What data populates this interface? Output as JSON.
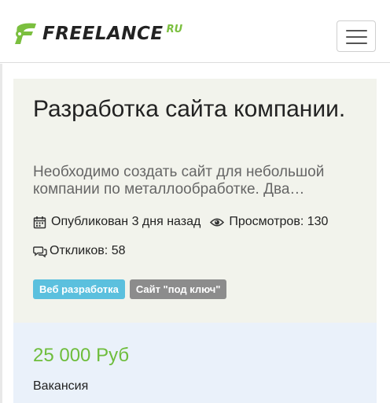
{
  "header": {
    "logo_text": "FREELANCE",
    "logo_suffix": "RU",
    "menu_button_icon": "hamburger-menu-icon"
  },
  "project": {
    "title": "Разработка сайта компании.",
    "description": "Необходимо создать сайт для небольшой компании по металлообработке. Два…",
    "published": "Опубликован 3 дня назад",
    "views": "Просмотров: 130",
    "responses": "Откликов: 58",
    "tags": [
      {
        "label": "Веб разработка",
        "color": "#5bc0de"
      },
      {
        "label": "Сайт \"под ключ\"",
        "color": "#8c8c8c"
      }
    ]
  },
  "offer": {
    "price": "25 000 Руб",
    "type": "Вакансия"
  },
  "colors": {
    "brand_green": "#7bbf3f",
    "price_green": "#6ebd3c",
    "card_bg": "#f2f3ec",
    "price_card_bg": "#eaf1fa"
  },
  "icons": {
    "published": "calendar-icon",
    "views": "eye-icon",
    "responses": "comments-icon"
  }
}
